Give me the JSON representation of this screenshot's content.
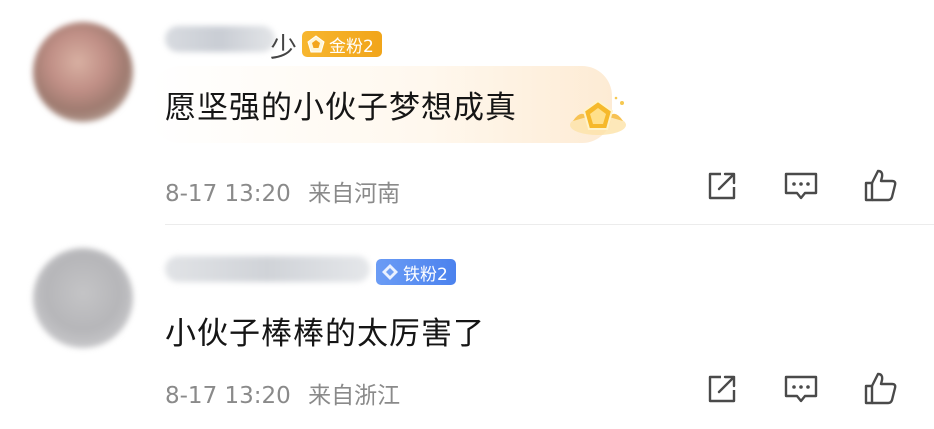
{
  "comments": [
    {
      "username_tail": "少",
      "badge": {
        "icon": "gold-pentagon-icon",
        "label": "金粉2",
        "color": "#f4ad22"
      },
      "text": "愿坚强的小伙子梦想成真",
      "date": "8-17 13:20",
      "location": "来自河南",
      "actions": [
        "share-icon",
        "reply-icon",
        "like-icon"
      ]
    },
    {
      "badge": {
        "icon": "diamond-icon",
        "label": "铁粉2",
        "color": "#5a8ff2"
      },
      "text": "小伙子棒棒的太厉害了",
      "date": "8-17 13:20",
      "location": "来自浙江",
      "actions": [
        "share-icon",
        "reply-icon",
        "like-icon"
      ]
    }
  ]
}
